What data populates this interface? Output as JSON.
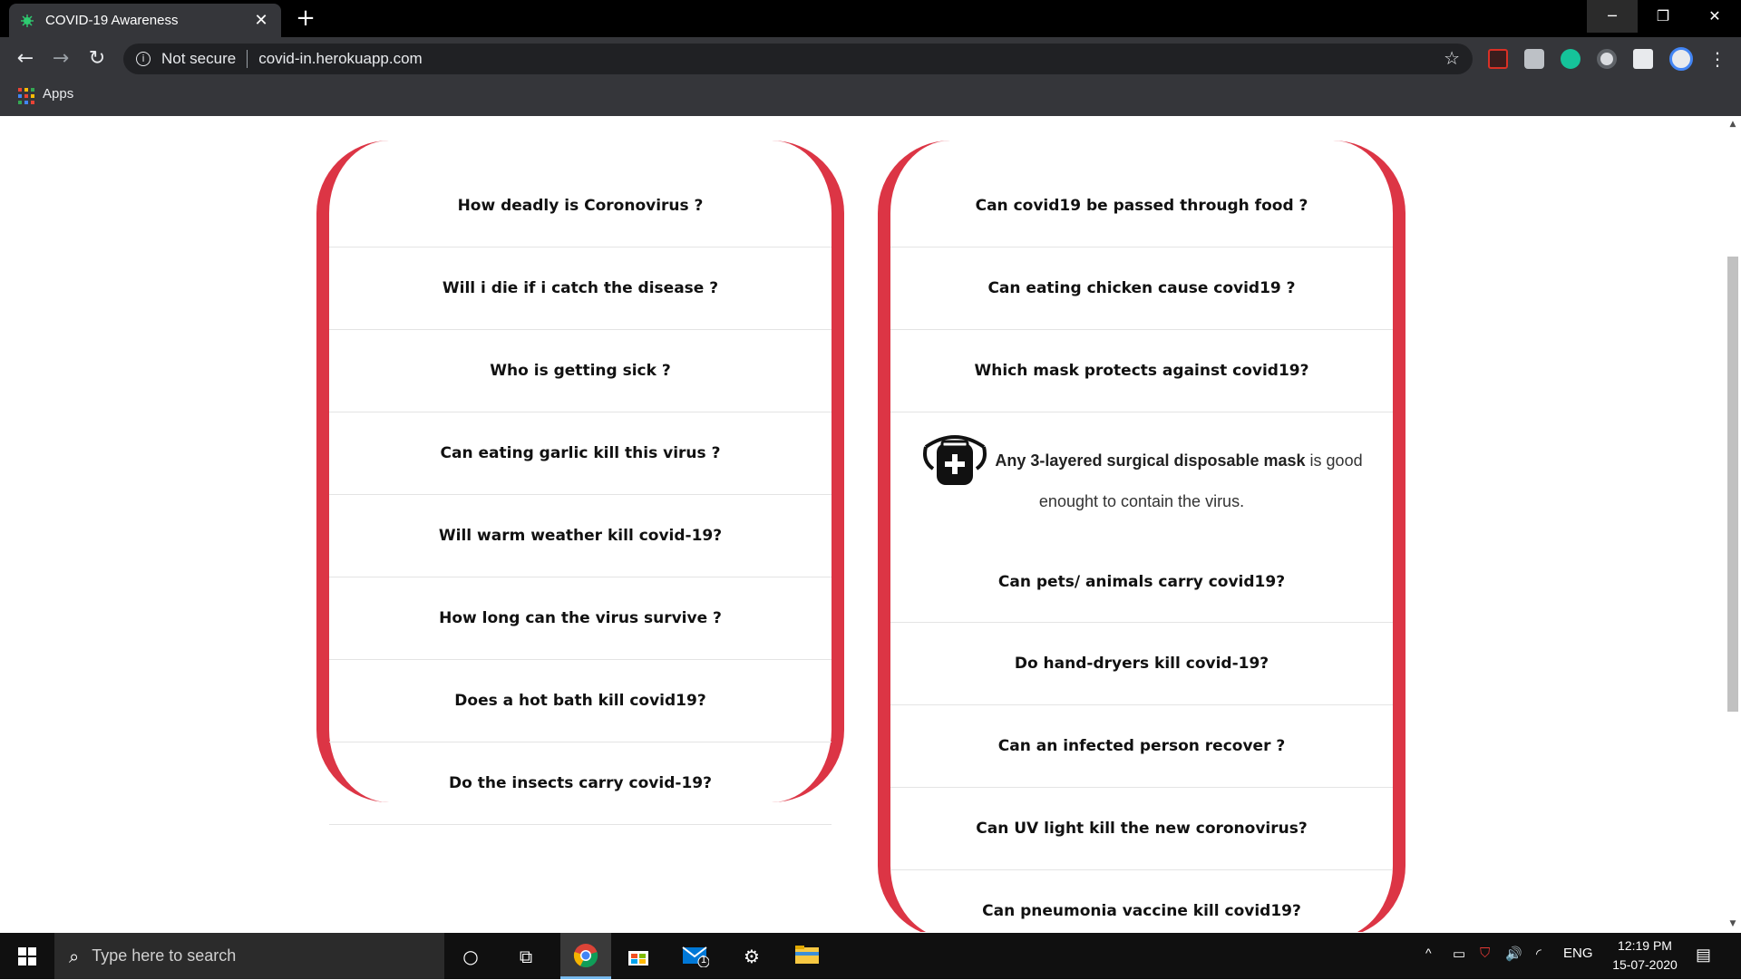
{
  "browser": {
    "tab_title": "COVID-19 Awareness",
    "tab_close": "✕",
    "new_tab": "+",
    "window_minimize": "─",
    "window_restore": "❐",
    "window_close": "✕",
    "back": "←",
    "forward": "→",
    "reload": "↻",
    "security_label": "Not secure",
    "url": "covid-in.herokuapp.com",
    "bookmark_star": "☆",
    "bookmarks_apps": "Apps"
  },
  "faq": {
    "left_questions": [
      "How deadly is Coronovirus ?",
      "Will i die if i catch the disease ?",
      "Who is getting sick ?",
      "Can eating garlic kill this virus ?",
      "Will warm weather kill covid-19?",
      "How long can the virus survive ?",
      "Does a hot bath kill covid19?",
      "Do the insects carry covid-19?"
    ],
    "right_questions_before": [
      "Can covid19 be passed through food ?",
      "Can eating chicken cause covid19 ?",
      "Which mask protects against covid19?"
    ],
    "expanded_answer": {
      "bold": "Any 3-layered surgical disposable mask",
      "rest": "is good",
      "line2": "enought to contain the virus.",
      "icon": "medical-mask-icon"
    },
    "right_questions_after": [
      "Can pets/ animals carry covid19?",
      "Do hand-dryers kill covid-19?",
      "Can an infected person recover ?",
      "Can UV light kill the new coronovirus?",
      "Can pneumonia vaccine kill covid19?"
    ]
  },
  "taskbar": {
    "search_placeholder": "Type here to search",
    "mail_badge": "1",
    "language": "ENG",
    "time": "12:19 PM",
    "date": "15-07-2020"
  },
  "colors": {
    "accent": "#dc3545",
    "browser_dark": "#35363a",
    "taskbar": "#101010"
  }
}
